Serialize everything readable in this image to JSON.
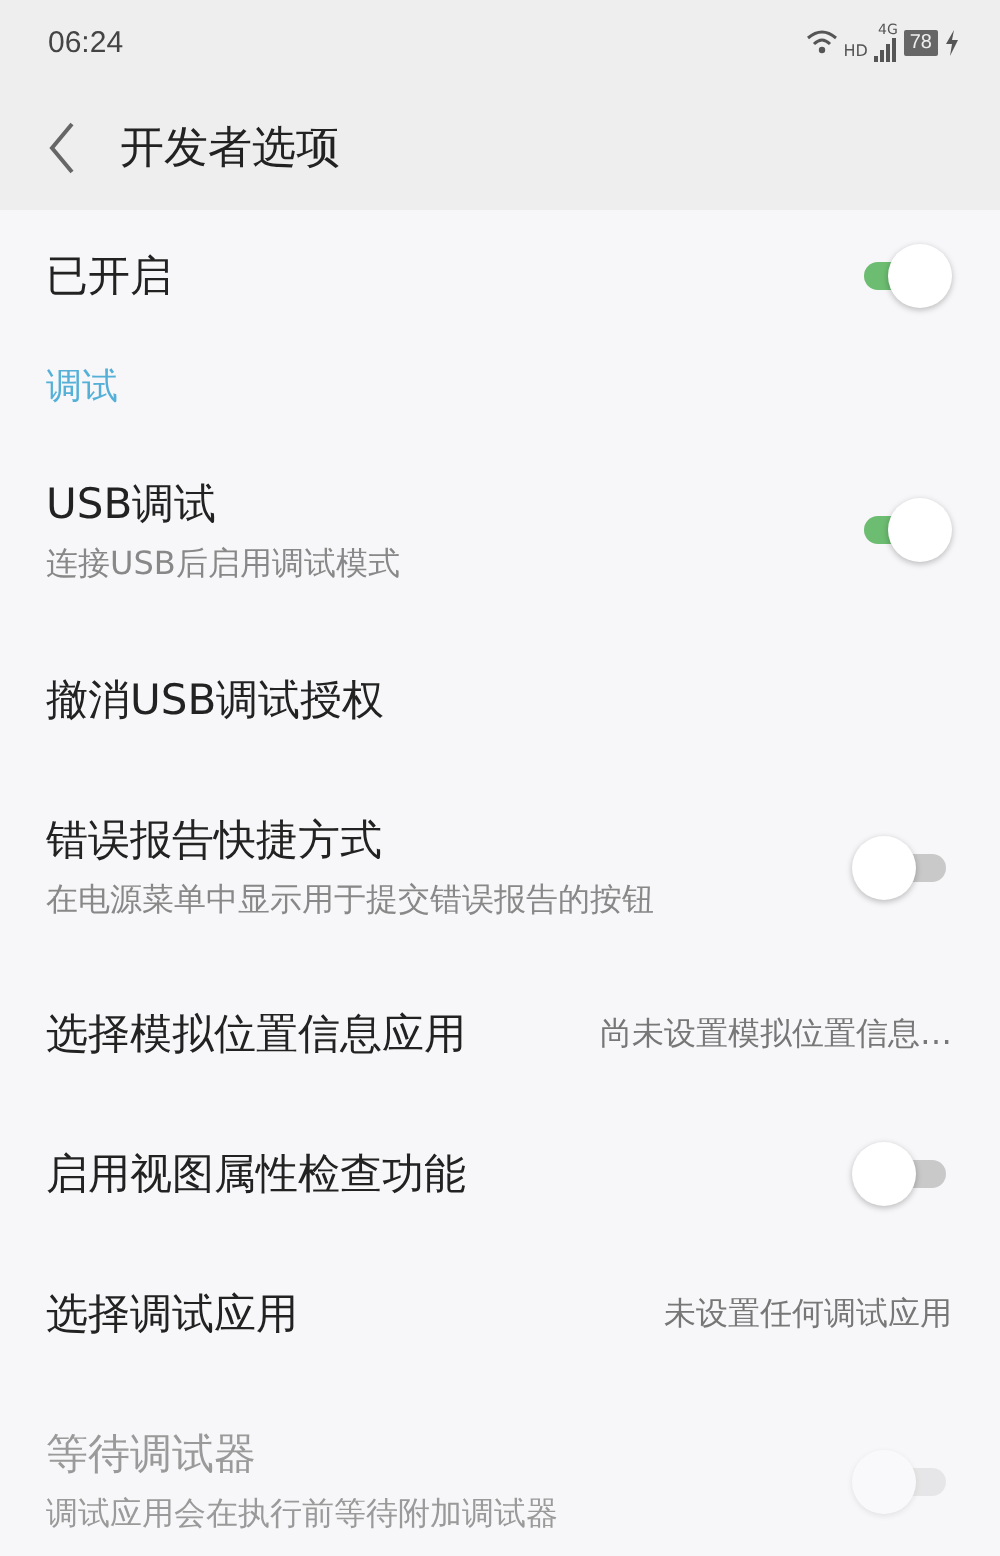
{
  "status_bar": {
    "time": "06:24",
    "network_hd": "HD",
    "network_type": "4G",
    "battery": "78"
  },
  "header": {
    "title": "开发者选项"
  },
  "master": {
    "label": "已开启",
    "on": true
  },
  "section": {
    "title": "调试"
  },
  "items": [
    {
      "kind": "toggle",
      "title": "USB调试",
      "subtitle": "连接USB后启用调试模式",
      "on": true,
      "disabled": false
    },
    {
      "kind": "action",
      "title": "撤消USB调试授权"
    },
    {
      "kind": "toggle",
      "title": "错误报告快捷方式",
      "subtitle": "在电源菜单中显示用于提交错误报告的按钮",
      "on": false,
      "disabled": false
    },
    {
      "kind": "value",
      "title": "选择模拟位置信息应用",
      "value": "尚未设置模拟位置信息…"
    },
    {
      "kind": "toggle",
      "title": "启用视图属性检查功能",
      "on": false,
      "disabled": false
    },
    {
      "kind": "value",
      "title": "选择调试应用",
      "value": "未设置任何调试应用"
    },
    {
      "kind": "toggle",
      "title": "等待调试器",
      "subtitle": "调试应用会在执行前等待附加调试器",
      "on": false,
      "disabled": true
    }
  ]
}
